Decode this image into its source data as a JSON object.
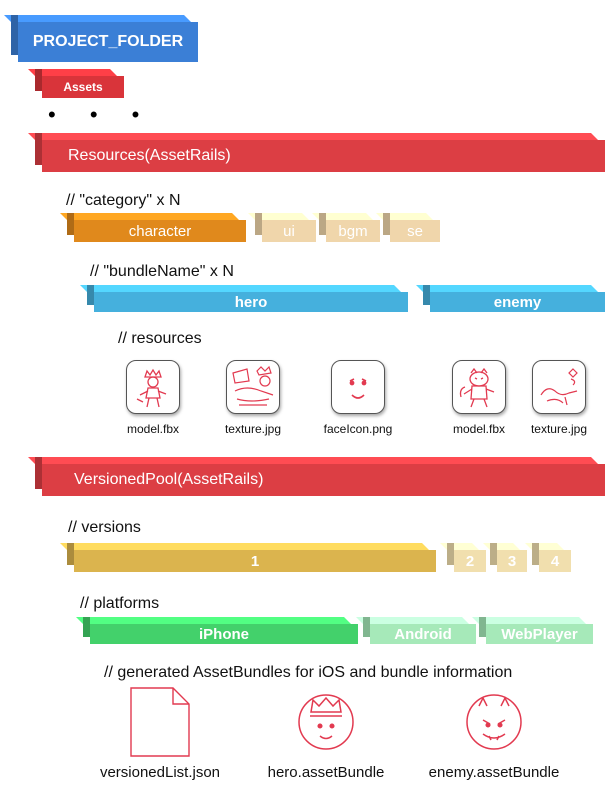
{
  "project_folder": {
    "label": "PROJECT_FOLDER",
    "color": "#3b7fd6"
  },
  "assets": {
    "label": "Assets",
    "color": "#d9343a"
  },
  "ellipsis": "• • •",
  "resources": {
    "title": "Resources(AssetRails)",
    "color": "#dc3e44",
    "category_comment": "// \"category\" x N",
    "categories": [
      {
        "label": "character",
        "selected": true
      },
      {
        "label": "ui",
        "selected": false
      },
      {
        "label": "bgm",
        "selected": false
      },
      {
        "label": "se",
        "selected": false
      }
    ],
    "bundle_comment": "// \"bundleName\" x N",
    "bundles": [
      {
        "label": "hero",
        "selected": true
      },
      {
        "label": "enemy",
        "selected": true
      }
    ],
    "resources_comment": "// resources",
    "files": [
      {
        "icon": "hero-model-icon",
        "label": "model.fbx"
      },
      {
        "icon": "hero-texture-icon",
        "label": "texture.jpg"
      },
      {
        "icon": "face-icon",
        "label": "faceIcon.png"
      },
      {
        "icon": "enemy-model-icon",
        "label": "model.fbx"
      },
      {
        "icon": "enemy-texture-icon",
        "label": "texture.jpg"
      }
    ]
  },
  "versioned_pool": {
    "title": "VersionedPool(AssetRails)",
    "color": "#dc3e44",
    "versions_comment": "// versions",
    "versions": [
      {
        "label": "1",
        "selected": true
      },
      {
        "label": "2",
        "selected": false
      },
      {
        "label": "3",
        "selected": false
      },
      {
        "label": "4",
        "selected": false
      }
    ],
    "platforms_comment": "// platforms",
    "platforms": [
      {
        "label": "iPhone",
        "selected": true
      },
      {
        "label": "Android",
        "selected": false
      },
      {
        "label": "WebPlayer",
        "selected": false
      }
    ],
    "generated_comment": "// generated AssetBundles for iOS and bundle information",
    "outputs": [
      {
        "icon": "document-icon",
        "label": "versionedList.json"
      },
      {
        "icon": "hero-bundle-icon",
        "label": "hero.assetBundle"
      },
      {
        "icon": "enemy-bundle-icon",
        "label": "enemy.assetBundle"
      }
    ]
  },
  "colors": {
    "category_active": "#e0891c",
    "category_inactive": "#f0d6ab",
    "bundle": "#45b0dd",
    "version_active": "#dbb44e",
    "version_inactive": "#f1dfae",
    "platform_active": "#43d16b",
    "platform_inactive": "#a6e9b9",
    "sketch": "#e23a50"
  }
}
